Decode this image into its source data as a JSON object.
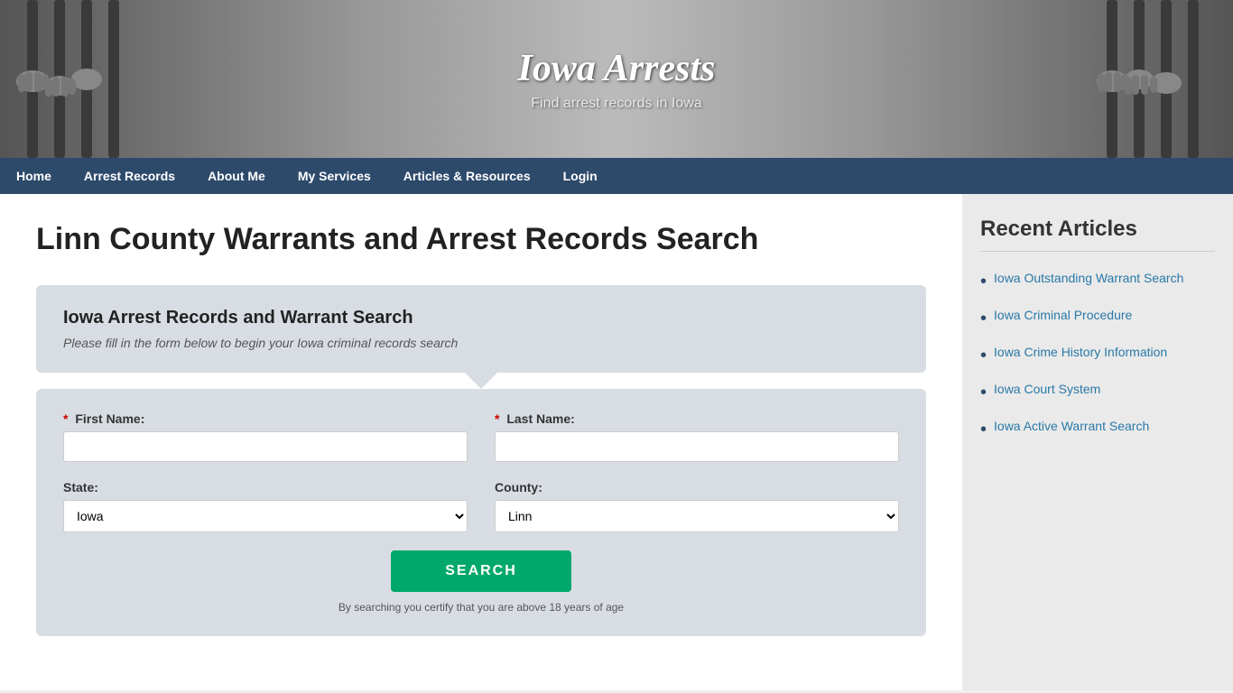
{
  "header": {
    "title": "Iowa Arrests",
    "tagline": "Find arrest records in Iowa"
  },
  "nav": {
    "items": [
      {
        "label": "Home",
        "href": "#"
      },
      {
        "label": "Arrest Records",
        "href": "#"
      },
      {
        "label": "About Me",
        "href": "#"
      },
      {
        "label": "My Services",
        "href": "#"
      },
      {
        "label": "Articles & Resources",
        "href": "#"
      },
      {
        "label": "Login",
        "href": "#"
      }
    ]
  },
  "main": {
    "page_title": "Linn County Warrants and Arrest Records Search",
    "form_box_title": "Iowa Arrest Records and Warrant Search",
    "form_box_subtitle": "Please fill in the form below to begin your Iowa criminal records search",
    "first_name_label": "First Name:",
    "last_name_label": "Last Name:",
    "state_label": "State:",
    "county_label": "County:",
    "state_value": "Iowa",
    "county_value": "Linn",
    "search_button": "SEARCH",
    "disclaimer": "By searching you certify that you are above 18 years of age"
  },
  "sidebar": {
    "title": "Recent Articles",
    "articles": [
      {
        "label": "Iowa Outstanding Warrant Search",
        "href": "#"
      },
      {
        "label": "Iowa Criminal Procedure",
        "href": "#"
      },
      {
        "label": "Iowa Crime History Information",
        "href": "#"
      },
      {
        "label": "Iowa Court System",
        "href": "#"
      },
      {
        "label": "Iowa Active Warrant Search",
        "href": "#"
      }
    ]
  }
}
